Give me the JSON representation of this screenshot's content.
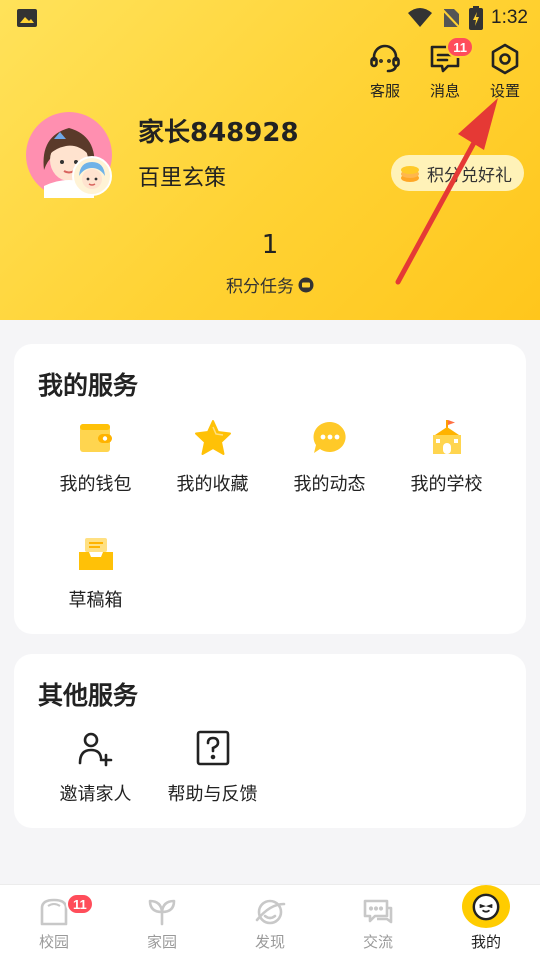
{
  "status_bar": {
    "time": "1:32"
  },
  "header_actions": [
    {
      "label": "客服",
      "icon": "headset-icon"
    },
    {
      "label": "消息",
      "icon": "message-icon",
      "badge": "11"
    },
    {
      "label": "设置",
      "icon": "settings-icon"
    }
  ],
  "profile": {
    "username": "家长848928",
    "subname": "百里玄策",
    "points_button": "积分兑好礼",
    "points_value": "1",
    "points_label": "积分任务"
  },
  "my_services": {
    "title": "我的服务",
    "items": [
      {
        "label": "我的钱包",
        "icon": "wallet-icon"
      },
      {
        "label": "我的收藏",
        "icon": "star-icon"
      },
      {
        "label": "我的动态",
        "icon": "chat-bubble-icon"
      },
      {
        "label": "我的学校",
        "icon": "school-icon"
      },
      {
        "label": "草稿箱",
        "icon": "drafts-icon"
      }
    ]
  },
  "other_services": {
    "title": "其他服务",
    "items": [
      {
        "label": "邀请家人",
        "icon": "add-person-icon"
      },
      {
        "label": "帮助与反馈",
        "icon": "help-icon"
      }
    ]
  },
  "tabs": [
    {
      "label": "校园",
      "icon": "campus-icon",
      "badge": "11"
    },
    {
      "label": "家园",
      "icon": "leaf-icon"
    },
    {
      "label": "发现",
      "icon": "planet-icon"
    },
    {
      "label": "交流",
      "icon": "chat-icon"
    },
    {
      "label": "我的",
      "icon": "mine-face-icon",
      "active": true
    }
  ],
  "colors": {
    "brand_yellow": "#ffd233",
    "badge_red": "#ff4d5a",
    "arrow_red": "#e53935"
  }
}
